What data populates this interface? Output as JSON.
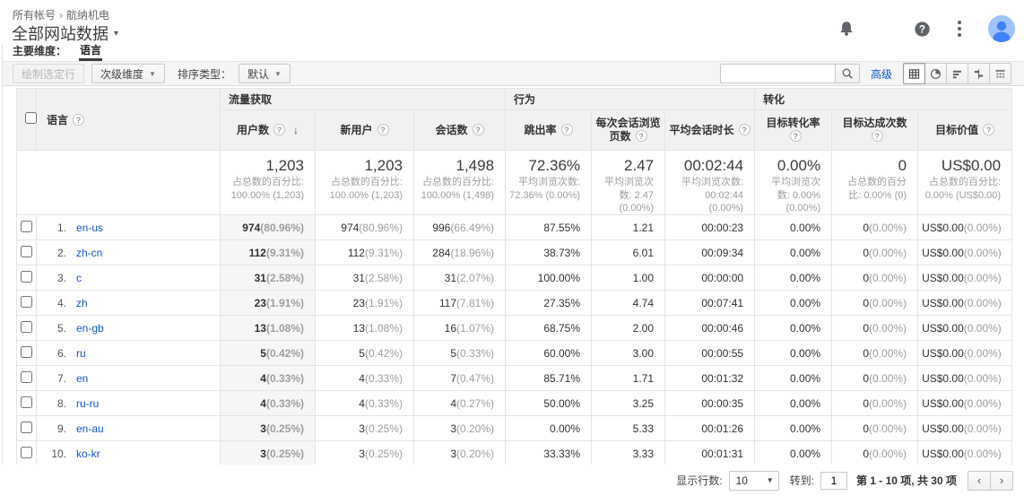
{
  "colors": {
    "link_blue": "#1155cc",
    "avatar_blue": "#4285f4",
    "toolbar_bg": "#f5f5f5",
    "header_bg": "#f1f1f1"
  },
  "header": {
    "breadcrumb": {
      "account": "所有帐号",
      "separator": "›",
      "property": "航纳机电"
    },
    "title": "全部网站数据",
    "title_caret": "▾"
  },
  "dimension_bar": {
    "label": "主要维度：",
    "active": "语言"
  },
  "toolbar": {
    "plot_rows": "绘制选定行",
    "secondary_dimension": "次级维度",
    "dropdown_caret": "▼",
    "sort_type_label": "排序类型：",
    "sort_type_value": "默认",
    "search_value": "",
    "advanced": "高级"
  },
  "table": {
    "dimension_header": "语言",
    "groups": [
      "流量获取",
      "行为",
      "转化"
    ],
    "columns": [
      "用户数",
      "新用户",
      "会话数",
      "跳出率",
      "每次会话浏览页数",
      "平均会话时长",
      "目标转化率",
      "目标达成次数",
      "目标价值"
    ],
    "sort_arrow": "↓",
    "summary": {
      "users": {
        "value": "1,203",
        "sub": "占总数的百分比: 100.00% (1,203)"
      },
      "new_users": {
        "value": "1,203",
        "sub": "占总数的百分比: 100.00% (1,203)"
      },
      "sessions": {
        "value": "1,498",
        "sub": "占总数的百分比: 100.00% (1,498)"
      },
      "bounce": {
        "value": "72.36%",
        "sub": "平均浏览次数: 72.36% (0.00%)"
      },
      "pages": {
        "value": "2.47",
        "sub": "平均浏览次数: 2.47 (0.00%)"
      },
      "duration": {
        "value": "00:02:44",
        "sub": "平均浏览次数: 00:02:44 (0.00%)"
      },
      "conv_rate": {
        "value": "0.00%",
        "sub": "平均浏览次数: 0.00% (0.00%)"
      },
      "completions": {
        "value": "0",
        "sub": "占总数的百分比: 0.00% (0)"
      },
      "goal_value": {
        "value": "US$0.00",
        "sub": "占总数的百分比: 0.00% (US$0.00)"
      }
    },
    "rows": [
      {
        "index": "1.",
        "language": "en-us",
        "users": "974",
        "users_pct": "(80.96%)",
        "new_users": "974",
        "new_users_pct": "(80.96%)",
        "sessions": "996",
        "sessions_pct": "(66.49%)",
        "bounce": "87.55%",
        "pages": "1.21",
        "duration": "00:00:23",
        "conv_rate": "0.00%",
        "completions": "0",
        "completions_pct": "(0.00%)",
        "goal_value": "US$0.00",
        "goal_value_pct": "(0.00%)"
      },
      {
        "index": "2.",
        "language": "zh-cn",
        "users": "112",
        "users_pct": "(9.31%)",
        "new_users": "112",
        "new_users_pct": "(9.31%)",
        "sessions": "284",
        "sessions_pct": "(18.96%)",
        "bounce": "38.73%",
        "pages": "6.01",
        "duration": "00:09:34",
        "conv_rate": "0.00%",
        "completions": "0",
        "completions_pct": "(0.00%)",
        "goal_value": "US$0.00",
        "goal_value_pct": "(0.00%)"
      },
      {
        "index": "3.",
        "language": "c",
        "users": "31",
        "users_pct": "(2.58%)",
        "new_users": "31",
        "new_users_pct": "(2.58%)",
        "sessions": "31",
        "sessions_pct": "(2.07%)",
        "bounce": "100.00%",
        "pages": "1.00",
        "duration": "00:00:00",
        "conv_rate": "0.00%",
        "completions": "0",
        "completions_pct": "(0.00%)",
        "goal_value": "US$0.00",
        "goal_value_pct": "(0.00%)"
      },
      {
        "index": "4.",
        "language": "zh",
        "users": "23",
        "users_pct": "(1.91%)",
        "new_users": "23",
        "new_users_pct": "(1.91%)",
        "sessions": "117",
        "sessions_pct": "(7.81%)",
        "bounce": "27.35%",
        "pages": "4.74",
        "duration": "00:07:41",
        "conv_rate": "0.00%",
        "completions": "0",
        "completions_pct": "(0.00%)",
        "goal_value": "US$0.00",
        "goal_value_pct": "(0.00%)"
      },
      {
        "index": "5.",
        "language": "en-gb",
        "users": "13",
        "users_pct": "(1.08%)",
        "new_users": "13",
        "new_users_pct": "(1.08%)",
        "sessions": "16",
        "sessions_pct": "(1.07%)",
        "bounce": "68.75%",
        "pages": "2.00",
        "duration": "00:00:46",
        "conv_rate": "0.00%",
        "completions": "0",
        "completions_pct": "(0.00%)",
        "goal_value": "US$0.00",
        "goal_value_pct": "(0.00%)"
      },
      {
        "index": "6.",
        "language": "ru",
        "users": "5",
        "users_pct": "(0.42%)",
        "new_users": "5",
        "new_users_pct": "(0.42%)",
        "sessions": "5",
        "sessions_pct": "(0.33%)",
        "bounce": "60.00%",
        "pages": "3.00",
        "duration": "00:00:55",
        "conv_rate": "0.00%",
        "completions": "0",
        "completions_pct": "(0.00%)",
        "goal_value": "US$0.00",
        "goal_value_pct": "(0.00%)"
      },
      {
        "index": "7.",
        "language": "en",
        "users": "4",
        "users_pct": "(0.33%)",
        "new_users": "4",
        "new_users_pct": "(0.33%)",
        "sessions": "7",
        "sessions_pct": "(0.47%)",
        "bounce": "85.71%",
        "pages": "1.71",
        "duration": "00:01:32",
        "conv_rate": "0.00%",
        "completions": "0",
        "completions_pct": "(0.00%)",
        "goal_value": "US$0.00",
        "goal_value_pct": "(0.00%)"
      },
      {
        "index": "8.",
        "language": "ru-ru",
        "users": "4",
        "users_pct": "(0.33%)",
        "new_users": "4",
        "new_users_pct": "(0.33%)",
        "sessions": "4",
        "sessions_pct": "(0.27%)",
        "bounce": "50.00%",
        "pages": "3.25",
        "duration": "00:00:35",
        "conv_rate": "0.00%",
        "completions": "0",
        "completions_pct": "(0.00%)",
        "goal_value": "US$0.00",
        "goal_value_pct": "(0.00%)"
      },
      {
        "index": "9.",
        "language": "en-au",
        "users": "3",
        "users_pct": "(0.25%)",
        "new_users": "3",
        "new_users_pct": "(0.25%)",
        "sessions": "3",
        "sessions_pct": "(0.20%)",
        "bounce": "0.00%",
        "pages": "5.33",
        "duration": "00:01:26",
        "conv_rate": "0.00%",
        "completions": "0",
        "completions_pct": "(0.00%)",
        "goal_value": "US$0.00",
        "goal_value_pct": "(0.00%)"
      },
      {
        "index": "10.",
        "language": "ko-kr",
        "users": "3",
        "users_pct": "(0.25%)",
        "new_users": "3",
        "new_users_pct": "(0.25%)",
        "sessions": "3",
        "sessions_pct": "(0.20%)",
        "bounce": "33.33%",
        "pages": "3.33",
        "duration": "00:01:31",
        "conv_rate": "0.00%",
        "completions": "0",
        "completions_pct": "(0.00%)",
        "goal_value": "US$0.00",
        "goal_value_pct": "(0.00%)"
      }
    ]
  },
  "footer": {
    "show_rows_label": "显示行数:",
    "rows_per_page": "10",
    "select_caret": "▼",
    "goto_label": "转到:",
    "goto_value": "1",
    "range_text": "第 1 - 10 项, 共 30 项",
    "prev_icon": "‹",
    "next_icon": "›"
  }
}
